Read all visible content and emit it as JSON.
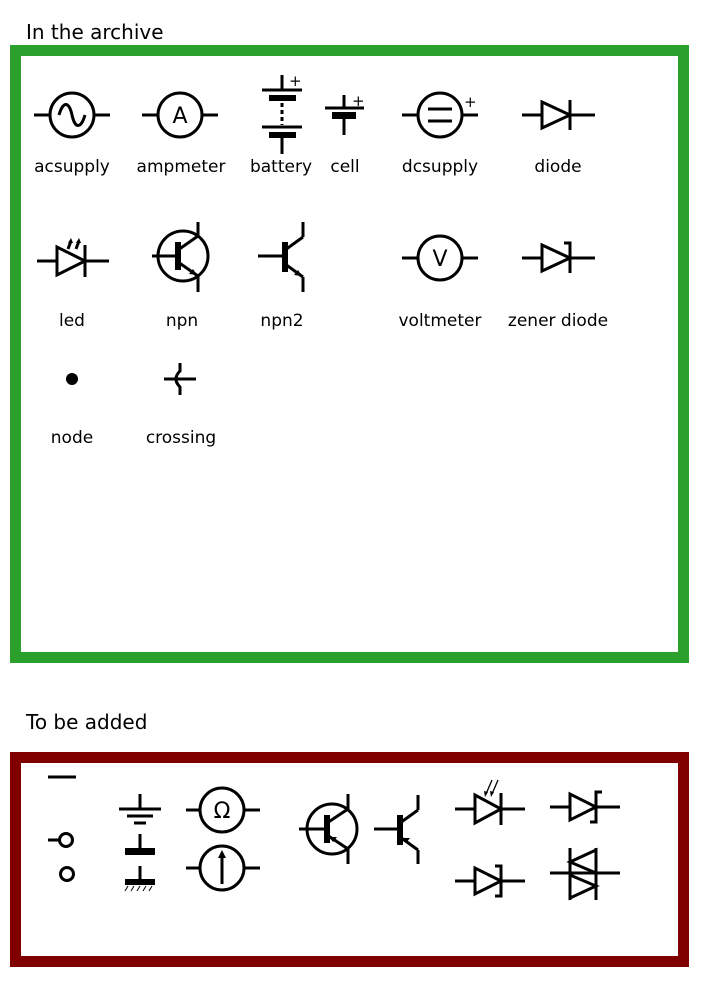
{
  "sections": {
    "archive": {
      "heading": "In the archive",
      "frame_color": "#2ca02c",
      "symbols": [
        {
          "id": "acsupply",
          "label": "acsupply"
        },
        {
          "id": "ampmeter",
          "label": "ampmeter",
          "glyph": "A"
        },
        {
          "id": "battery",
          "label": "battery",
          "polarity": "+"
        },
        {
          "id": "cell",
          "label": "cell",
          "polarity": "+"
        },
        {
          "id": "dcsupply",
          "label": "dcsupply",
          "polarity": "+"
        },
        {
          "id": "diode",
          "label": "diode"
        },
        {
          "id": "led",
          "label": "led"
        },
        {
          "id": "npn",
          "label": "npn"
        },
        {
          "id": "npn2",
          "label": "npn2"
        },
        {
          "id": "voltmeter",
          "label": "voltmeter",
          "glyph": "V"
        },
        {
          "id": "zener-diode",
          "label": "zener diode"
        },
        {
          "id": "node",
          "label": "node"
        },
        {
          "id": "crossing",
          "label": "crossing"
        }
      ]
    },
    "to_add": {
      "heading": "To be added",
      "frame_color": "#800000",
      "symbols": [
        {
          "id": "wire-segment"
        },
        {
          "id": "terminal-with-lead"
        },
        {
          "id": "terminal-open"
        },
        {
          "id": "earth-ground"
        },
        {
          "id": "signal-ground"
        },
        {
          "id": "chassis-ground"
        },
        {
          "id": "ohmmeter",
          "glyph": "Ω"
        },
        {
          "id": "current-source"
        },
        {
          "id": "pnp-circled"
        },
        {
          "id": "pnp"
        },
        {
          "id": "photodiode"
        },
        {
          "id": "schottky-diode"
        },
        {
          "id": "zener-diode-alt"
        },
        {
          "id": "diac"
        }
      ]
    }
  }
}
